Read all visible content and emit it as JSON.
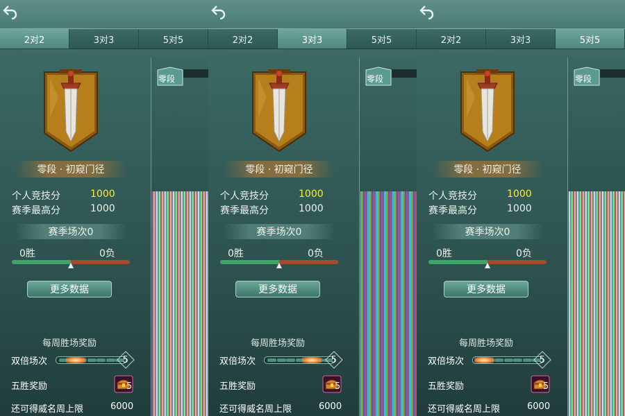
{
  "panels": [
    {
      "active_tab": 0
    },
    {
      "active_tab": 1
    },
    {
      "active_tab": 2
    }
  ],
  "tabs": [
    "2对2",
    "3对3",
    "5对5"
  ],
  "rank": {
    "name": "零段 · 初窥门径",
    "badge": "零段"
  },
  "stats": {
    "personal_label": "个人竞技分",
    "personal_value": "1000",
    "season_high_label": "赛季最高分",
    "season_high_value": "1000"
  },
  "season": {
    "matches_label": "赛季场次0",
    "wins": "0胜",
    "losses": "0负",
    "win_ratio": 0.5
  },
  "more_data_button": "更多数据",
  "weekly": {
    "title": "每周胜场奖励",
    "double_label": "双倍场次",
    "double_count": "5",
    "five_win_label": "五胜奖励",
    "chest_count": "5",
    "fame_label": "还可得威名周上限",
    "fame_value": "6000"
  },
  "colors": {
    "gold": "#ffe844",
    "tab_active": "#5f998e",
    "win": "#3fa36a",
    "loss": "#a44a2e"
  },
  "icons": {
    "back": "back-arrow-icon",
    "emblem": "sword-banner-icon",
    "chest": "treasure-chest-icon"
  }
}
